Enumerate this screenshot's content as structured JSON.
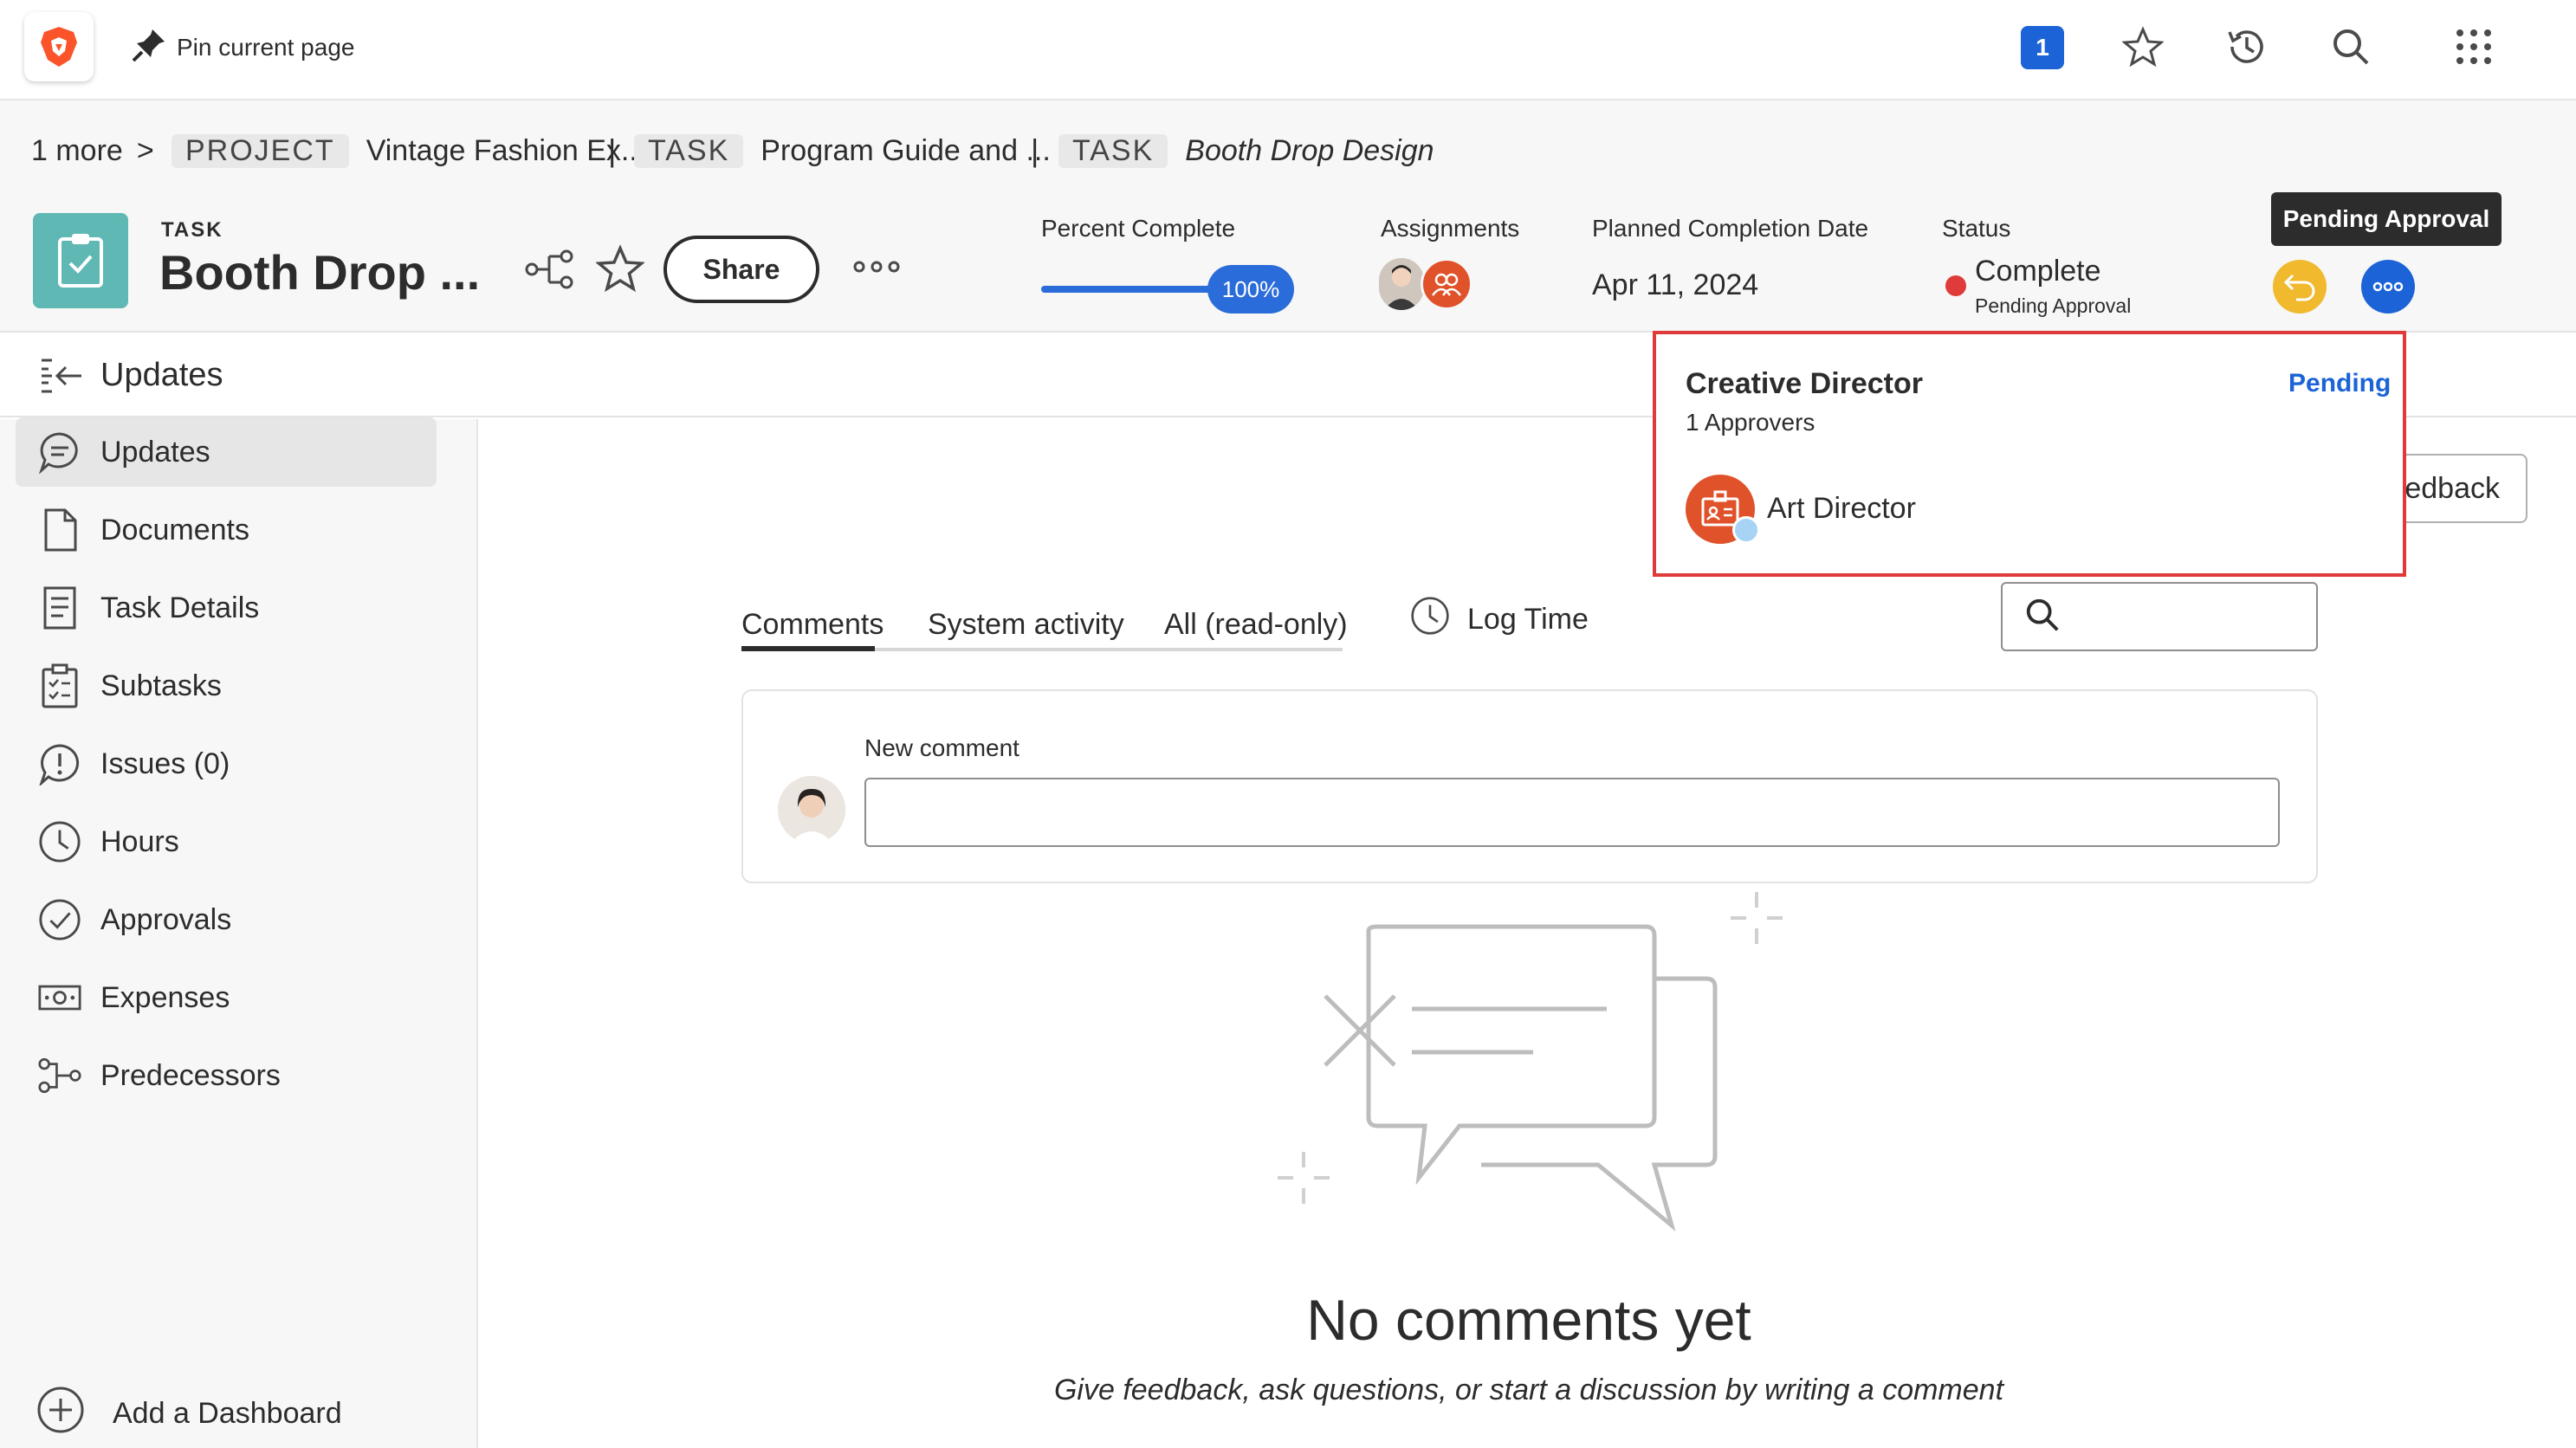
{
  "topbar": {
    "pin_label": "Pin current page",
    "notification_count": "1"
  },
  "breadcrumb": {
    "more": "1 more",
    "more_chevron": ">",
    "items": [
      {
        "tag": "PROJECT",
        "label": "Vintage Fashion Ex..."
      },
      {
        "tag": "TASK",
        "label": "Program Guide and ..."
      },
      {
        "tag": "TASK",
        "label": "Booth Drop Design"
      }
    ],
    "separator": "|"
  },
  "task": {
    "type": "TASK",
    "title": "Booth Drop ...",
    "share_label": "Share"
  },
  "fields": {
    "percent_complete_label": "Percent Complete",
    "percent_complete_value": "100%",
    "percent_complete_fraction": 1.0,
    "assignments_label": "Assignments",
    "planned_completion_label": "Planned Completion Date",
    "planned_completion_value": "Apr 11, 2024",
    "status_label": "Status",
    "status_value": "Complete",
    "status_sub": "Pending Approval",
    "status_color": "#e03a3a"
  },
  "tooltip": "Pending Approval",
  "updates_bar": {
    "title": "Updates"
  },
  "sidebar": {
    "items": [
      {
        "label": "Updates",
        "icon": "comment-icon"
      },
      {
        "label": "Documents",
        "icon": "document-icon"
      },
      {
        "label": "Task Details",
        "icon": "details-icon"
      },
      {
        "label": "Subtasks",
        "icon": "clipboard-icon"
      },
      {
        "label": "Issues (0)",
        "icon": "issue-icon"
      },
      {
        "label": "Hours",
        "icon": "clock-icon"
      },
      {
        "label": "Approvals",
        "icon": "check-circle-icon"
      },
      {
        "label": "Expenses",
        "icon": "money-icon"
      },
      {
        "label": "Predecessors",
        "icon": "hierarchy-icon"
      }
    ],
    "add_dashboard": "Add a Dashboard"
  },
  "main": {
    "tabs": [
      "Comments",
      "System activity",
      "All (read-only)"
    ],
    "log_time": "Log Time",
    "feedback_label": "edback",
    "new_comment_label": "New comment",
    "empty_title": "No comments yet",
    "empty_subtitle": "Give feedback, ask questions, or start a discussion by writing a comment"
  },
  "popover": {
    "title": "Creative Director",
    "status": "Pending",
    "approvers": "1 Approvers",
    "approver_name": "Art Director"
  },
  "colors": {
    "accent": "#1b63d6",
    "task_icon": "#5fb8b4",
    "undo": "#f0b92e",
    "popover_border": "#e03a3a"
  }
}
